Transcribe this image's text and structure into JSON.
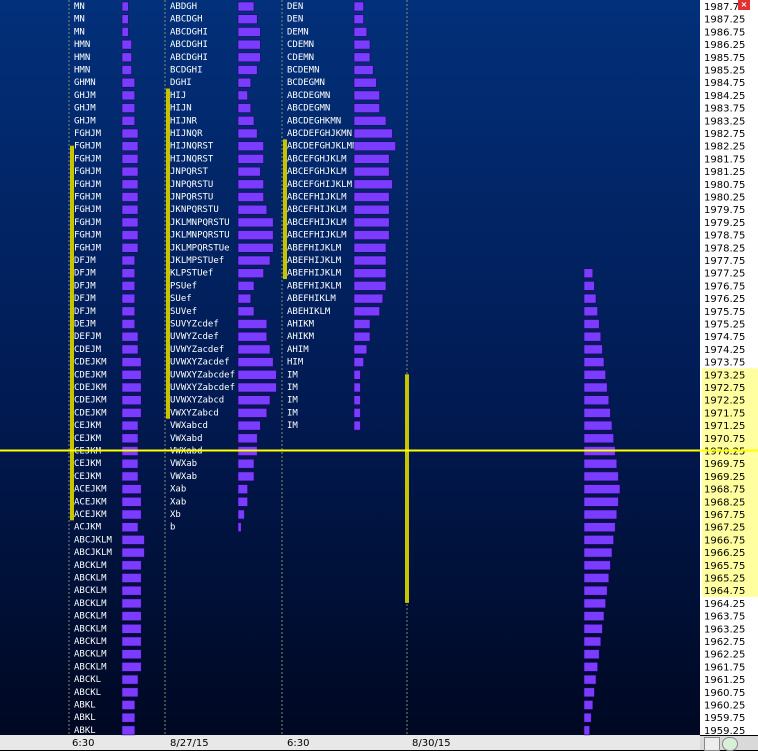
{
  "chart_data": {
    "type": "market-profile",
    "title": "",
    "price_axis": {
      "min": 1959.25,
      "max": 1987.75,
      "step": 0.5,
      "highlight_range": [
        1964.75,
        1973.25
      ],
      "highlight_color": "#ffffa0"
    },
    "current_price": 1970.25,
    "current_price_color": "#ffff00",
    "date_labels": [
      "6:30",
      "8/27/15",
      "6:30",
      "8/30/15"
    ],
    "sessions": [
      {
        "name": "session-1",
        "tpo_range": [
          1959.25,
          1987.75
        ],
        "value_area": [
          1967.5,
          1982.25
        ],
        "tpo_rows": [
          {
            "price": 1987.75,
            "letters": "MN"
          },
          {
            "price": 1987.25,
            "letters": "MN"
          },
          {
            "price": 1986.75,
            "letters": "MN"
          },
          {
            "price": 1986.25,
            "letters": "HMN"
          },
          {
            "price": 1985.75,
            "letters": "HMN"
          },
          {
            "price": 1985.25,
            "letters": "HMN"
          },
          {
            "price": 1984.75,
            "letters": "GHMN"
          },
          {
            "price": 1984.25,
            "letters": "GHJM"
          },
          {
            "price": 1983.75,
            "letters": "GHJM"
          },
          {
            "price": 1983.25,
            "letters": "GHJM"
          },
          {
            "price": 1982.75,
            "letters": "FGHJM"
          },
          {
            "price": 1982.25,
            "letters": "FGHJM"
          },
          {
            "price": 1981.75,
            "letters": "FGHJM"
          },
          {
            "price": 1981.25,
            "letters": "FGHJM"
          },
          {
            "price": 1980.75,
            "letters": "FGHJM"
          },
          {
            "price": 1980.25,
            "letters": "FGHJM"
          },
          {
            "price": 1979.75,
            "letters": "FGHJM"
          },
          {
            "price": 1979.25,
            "letters": "FGHJM"
          },
          {
            "price": 1978.75,
            "letters": "FGHJM"
          },
          {
            "price": 1978.25,
            "letters": "FGHJM"
          },
          {
            "price": 1977.75,
            "letters": "DFJM"
          },
          {
            "price": 1977.25,
            "letters": "DFJM"
          },
          {
            "price": 1976.75,
            "letters": "DFJM"
          },
          {
            "price": 1976.25,
            "letters": "DFJM"
          },
          {
            "price": 1975.75,
            "letters": "DFJM"
          },
          {
            "price": 1975.25,
            "letters": "DEJM"
          },
          {
            "price": 1974.75,
            "letters": "DEFJM"
          },
          {
            "price": 1974.25,
            "letters": "CDEJM"
          },
          {
            "price": 1973.75,
            "letters": "CDEJKM"
          },
          {
            "price": 1973.25,
            "letters": "CDEJKM"
          },
          {
            "price": 1972.75,
            "letters": "CDEJKM"
          },
          {
            "price": 1972.25,
            "letters": "CDEJKM"
          },
          {
            "price": 1971.75,
            "letters": "CDEJKM"
          },
          {
            "price": 1971.25,
            "letters": "CEJKM"
          },
          {
            "price": 1970.75,
            "letters": "CEJKM"
          },
          {
            "price": 1970.25,
            "letters": "CEJKM"
          },
          {
            "price": 1969.75,
            "letters": "CEJKM"
          },
          {
            "price": 1969.25,
            "letters": "CEJKM"
          },
          {
            "price": 1968.75,
            "letters": "ACEJKM"
          },
          {
            "price": 1968.25,
            "letters": "ACEJKM"
          },
          {
            "price": 1967.75,
            "letters": "ACEJKM"
          },
          {
            "price": 1967.25,
            "letters": "ACJKM"
          },
          {
            "price": 1966.75,
            "letters": "ABCJKLM"
          },
          {
            "price": 1966.25,
            "letters": "ABCJKLM"
          },
          {
            "price": 1965.75,
            "letters": "ABCKLM"
          },
          {
            "price": 1965.25,
            "letters": "ABCKLM"
          },
          {
            "price": 1964.75,
            "letters": "ABCKLM"
          },
          {
            "price": 1964.25,
            "letters": "ABCKLM"
          },
          {
            "price": 1963.75,
            "letters": "ABCKLM"
          },
          {
            "price": 1963.25,
            "letters": "ABCKLM"
          },
          {
            "price": 1962.75,
            "letters": "ABCKLM"
          },
          {
            "price": 1962.25,
            "letters": "ABCKLM"
          },
          {
            "price": 1961.75,
            "letters": "ABCKLM"
          },
          {
            "price": 1961.25,
            "letters": "ABCKL"
          },
          {
            "price": 1960.75,
            "letters": "ABCKL"
          },
          {
            "price": 1960.25,
            "letters": "ABKL"
          },
          {
            "price": 1959.75,
            "letters": "ABKL"
          },
          {
            "price": 1959.25,
            "letters": "ABKL"
          }
        ]
      },
      {
        "name": "session-2",
        "tpo_range": [
          1967.25,
          1987.75
        ],
        "value_area": [
          1971.5,
          1984.5
        ],
        "tpo_rows": [
          {
            "price": 1987.75,
            "letters": "ABDGH"
          },
          {
            "price": 1987.25,
            "letters": "ABCDGH"
          },
          {
            "price": 1986.75,
            "letters": "ABCDGHI"
          },
          {
            "price": 1986.25,
            "letters": "ABCDGHI"
          },
          {
            "price": 1985.75,
            "letters": "ABCDGHI"
          },
          {
            "price": 1985.25,
            "letters": "BCDGHI"
          },
          {
            "price": 1984.75,
            "letters": "DGHI"
          },
          {
            "price": 1984.25,
            "letters": "HIJ"
          },
          {
            "price": 1983.75,
            "letters": "HIJN"
          },
          {
            "price": 1983.25,
            "letters": "HIJNR"
          },
          {
            "price": 1982.75,
            "letters": "HIJNQR"
          },
          {
            "price": 1982.25,
            "letters": "HIJNQRST"
          },
          {
            "price": 1981.75,
            "letters": "HIJNQRST"
          },
          {
            "price": 1981.25,
            "letters": "JNPQRST"
          },
          {
            "price": 1980.75,
            "letters": "JNPQRSTU"
          },
          {
            "price": 1980.25,
            "letters": "JNPQRSTU"
          },
          {
            "price": 1979.75,
            "letters": "JKNPQRSTU"
          },
          {
            "price": 1979.25,
            "letters": "JKLMNPQRSTU"
          },
          {
            "price": 1978.75,
            "letters": "JKLMNPQRSTU"
          },
          {
            "price": 1978.25,
            "letters": "JKLMPQRSTUe"
          },
          {
            "price": 1977.75,
            "letters": "JKLMPSTUef"
          },
          {
            "price": 1977.25,
            "letters": "KLPSTUef"
          },
          {
            "price": 1976.75,
            "letters": "PSUef"
          },
          {
            "price": 1976.25,
            "letters": "SUef"
          },
          {
            "price": 1975.75,
            "letters": "SUVef"
          },
          {
            "price": 1975.25,
            "letters": "SUVYZcdef"
          },
          {
            "price": 1974.75,
            "letters": "UVWYZcdef"
          },
          {
            "price": 1974.25,
            "letters": "UVWYZacdef"
          },
          {
            "price": 1973.75,
            "letters": "UVWXYZacdef"
          },
          {
            "price": 1973.25,
            "letters": "UVWXYZabcdef"
          },
          {
            "price": 1972.75,
            "letters": "UVWXYZabcdef"
          },
          {
            "price": 1972.25,
            "letters": "UVWXYZabcd"
          },
          {
            "price": 1971.75,
            "letters": "VWXYZabcd"
          },
          {
            "price": 1971.25,
            "letters": "VWXabcd"
          },
          {
            "price": 1970.75,
            "letters": "VWXabd"
          },
          {
            "price": 1970.25,
            "letters": "VWXabd"
          },
          {
            "price": 1969.75,
            "letters": "VWXab"
          },
          {
            "price": 1969.25,
            "letters": "VWXab"
          },
          {
            "price": 1968.75,
            "letters": "Xab"
          },
          {
            "price": 1968.25,
            "letters": "Xab"
          },
          {
            "price": 1967.75,
            "letters": "Xb"
          },
          {
            "price": 1967.25,
            "letters": "b"
          }
        ]
      },
      {
        "name": "session-3",
        "tpo_range": [
          1971.25,
          1987.75
        ],
        "value_area": [
          1977.0,
          1982.5
        ],
        "tpo_rows": [
          {
            "price": 1987.75,
            "letters": "DEN"
          },
          {
            "price": 1987.25,
            "letters": "DEN"
          },
          {
            "price": 1986.75,
            "letters": "DEMN"
          },
          {
            "price": 1986.25,
            "letters": "CDEMN"
          },
          {
            "price": 1985.75,
            "letters": "CDEMN"
          },
          {
            "price": 1985.25,
            "letters": "BCDEMN"
          },
          {
            "price": 1984.75,
            "letters": "BCDEGMN"
          },
          {
            "price": 1984.25,
            "letters": "ABCDEGMN"
          },
          {
            "price": 1983.75,
            "letters": "ABCDEGMN"
          },
          {
            "price": 1983.25,
            "letters": "ABCDEGHKMN"
          },
          {
            "price": 1982.75,
            "letters": "ABCDEFGHJKMN"
          },
          {
            "price": 1982.25,
            "letters": "ABCDEFGHJKLMN"
          },
          {
            "price": 1981.75,
            "letters": "ABCEFGHJKLM"
          },
          {
            "price": 1981.25,
            "letters": "ABCEFGHJKLM"
          },
          {
            "price": 1980.75,
            "letters": "ABCEFGHIJKLM"
          },
          {
            "price": 1980.25,
            "letters": "ABCEFHIJKLM"
          },
          {
            "price": 1979.75,
            "letters": "ABCEFHIJKLM"
          },
          {
            "price": 1979.25,
            "letters": "ABCEFHIJKLM"
          },
          {
            "price": 1978.75,
            "letters": "ABCEFHIJKLM"
          },
          {
            "price": 1978.25,
            "letters": "ABEFHIJKLM"
          },
          {
            "price": 1977.75,
            "letters": "ABEFHIJKLM"
          },
          {
            "price": 1977.25,
            "letters": "ABEFHIJKLM"
          },
          {
            "price": 1976.75,
            "letters": "ABEFHIJKLM"
          },
          {
            "price": 1976.25,
            "letters": "ABEFHIKLM"
          },
          {
            "price": 1975.75,
            "letters": "ABEHIKLM"
          },
          {
            "price": 1975.25,
            "letters": "AHIKM"
          },
          {
            "price": 1974.75,
            "letters": "AHIKM"
          },
          {
            "price": 1974.25,
            "letters": "AHIM"
          },
          {
            "price": 1973.75,
            "letters": "HIM"
          },
          {
            "price": 1973.25,
            "letters": "IM"
          },
          {
            "price": 1972.75,
            "letters": "IM"
          },
          {
            "price": 1972.25,
            "letters": "IM"
          },
          {
            "price": 1971.75,
            "letters": "IM"
          },
          {
            "price": 1971.25,
            "letters": "IM"
          }
        ]
      },
      {
        "name": "session-4",
        "tpo_range": [
          1959.25,
          1977.25
        ],
        "value_area": [
          1964.25,
          1973.25
        ],
        "tpo_rows": []
      }
    ]
  }
}
